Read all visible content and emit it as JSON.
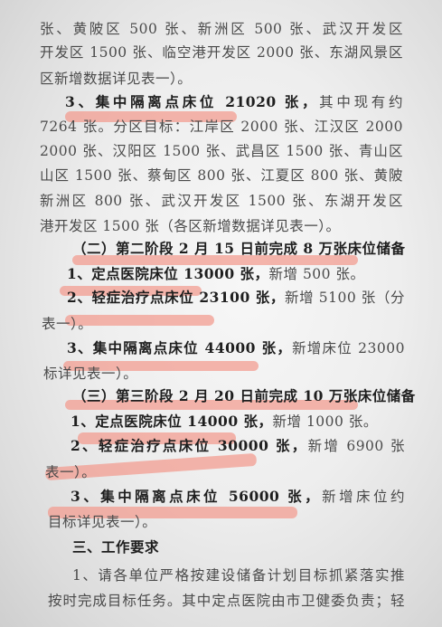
{
  "document": {
    "highlight_color": "#f39a8e",
    "lines": [
      {
        "parts": [
          {
            "t": "张、黄陂区 500 张、新洲区 500 张、武汉开发区 1500 张、东湖",
            "b": false
          }
        ]
      },
      {
        "parts": [
          {
            "t": "开发区 1500 张、临空港开发区 2000 张、东湖风景区 200 张（各",
            "b": false
          }
        ]
      },
      {
        "parts": [
          {
            "t": "区新增数据详见表一）。",
            "b": false
          }
        ]
      },
      {
        "parts": [
          {
            "t": "3、集中隔离点床位 21020 张，",
            "b": true
          },
          {
            "t": "其中现有约 13756 张，新增",
            "b": false
          }
        ]
      },
      {
        "parts": [
          {
            "t": "7264 张。分区目标：江岸区 2000 张、江汉区 2000 张、硚口区",
            "b": false
          }
        ]
      },
      {
        "parts": [
          {
            "t": "2000 张、汉阳区 1500 张、武昌区 1500 张、青山区 1000 张、洪",
            "b": false
          }
        ]
      },
      {
        "parts": [
          {
            "t": "山区 1500 张、蔡甸区 800 张、江夏区 800 张、黄陂区 2275 张、",
            "b": false
          }
        ]
      },
      {
        "parts": [
          {
            "t": "新洲区 800 张、武汉开发区 1500 张、东湖开发区 1500 张、临空",
            "b": false
          }
        ]
      },
      {
        "parts": [
          {
            "t": "港开发区 1500 张（各区新增数据详见表一）。",
            "b": false
          }
        ]
      },
      {
        "parts": [
          {
            "t": "（二）第二阶段 2 月 15 日前完成 8 万张床位储备",
            "b": true
          }
        ]
      },
      {
        "parts": [
          {
            "t": "1、定点医院床位 13000 张，",
            "b": true
          },
          {
            "t": "新增 500 张。",
            "b": false
          }
        ]
      },
      {
        "parts": [
          {
            "t": "2、轻症治疗点床位 23100 张，",
            "b": true
          },
          {
            "t": "新增 5100 张（分区目标详见",
            "b": false
          }
        ]
      },
      {
        "parts": [
          {
            "t": "表一）。",
            "b": false
          }
        ]
      },
      {
        "parts": [
          {
            "t": "3、集中隔离点床位 44000 张，",
            "b": true
          },
          {
            "t": "新增床位 23000 张（分区目",
            "b": false
          }
        ]
      },
      {
        "parts": [
          {
            "t": "标详见表一）。",
            "b": false
          }
        ]
      },
      {
        "parts": [
          {
            "t": "（三）第三阶段 2 月 20 日前完成 10 万张床位储备",
            "b": true
          }
        ]
      },
      {
        "parts": [
          {
            "t": "1、定点医院床位 14000 张，",
            "b": true
          },
          {
            "t": "新增 1000 张。",
            "b": false
          }
        ]
      },
      {
        "parts": [
          {
            "t": "2、轻症治疗点床位 30000 张，",
            "b": true
          },
          {
            "t": "新增 6900 张（分区目标详见",
            "b": false
          }
        ]
      },
      {
        "parts": [
          {
            "t": "表一）。",
            "b": false
          }
        ]
      },
      {
        "parts": [
          {
            "t": "3、集中隔离点床位 56000 张，",
            "b": true
          },
          {
            "t": "新增床位约 12000 张（分区",
            "b": false
          }
        ]
      },
      {
        "parts": [
          {
            "t": "目标详见表一）。",
            "b": false
          }
        ]
      },
      {
        "parts": [
          {
            "t": "三、工作要求",
            "b": true
          }
        ]
      },
      {
        "parts": [
          {
            "t": "1、请各单位严格按建设储备计划目标抓紧落实推进，确保",
            "b": false
          }
        ]
      },
      {
        "parts": [
          {
            "t": "按时完成目标任务。其中定点医院由市卫健委负责；轻症治疗点",
            "b": false
          }
        ]
      }
    ]
  }
}
